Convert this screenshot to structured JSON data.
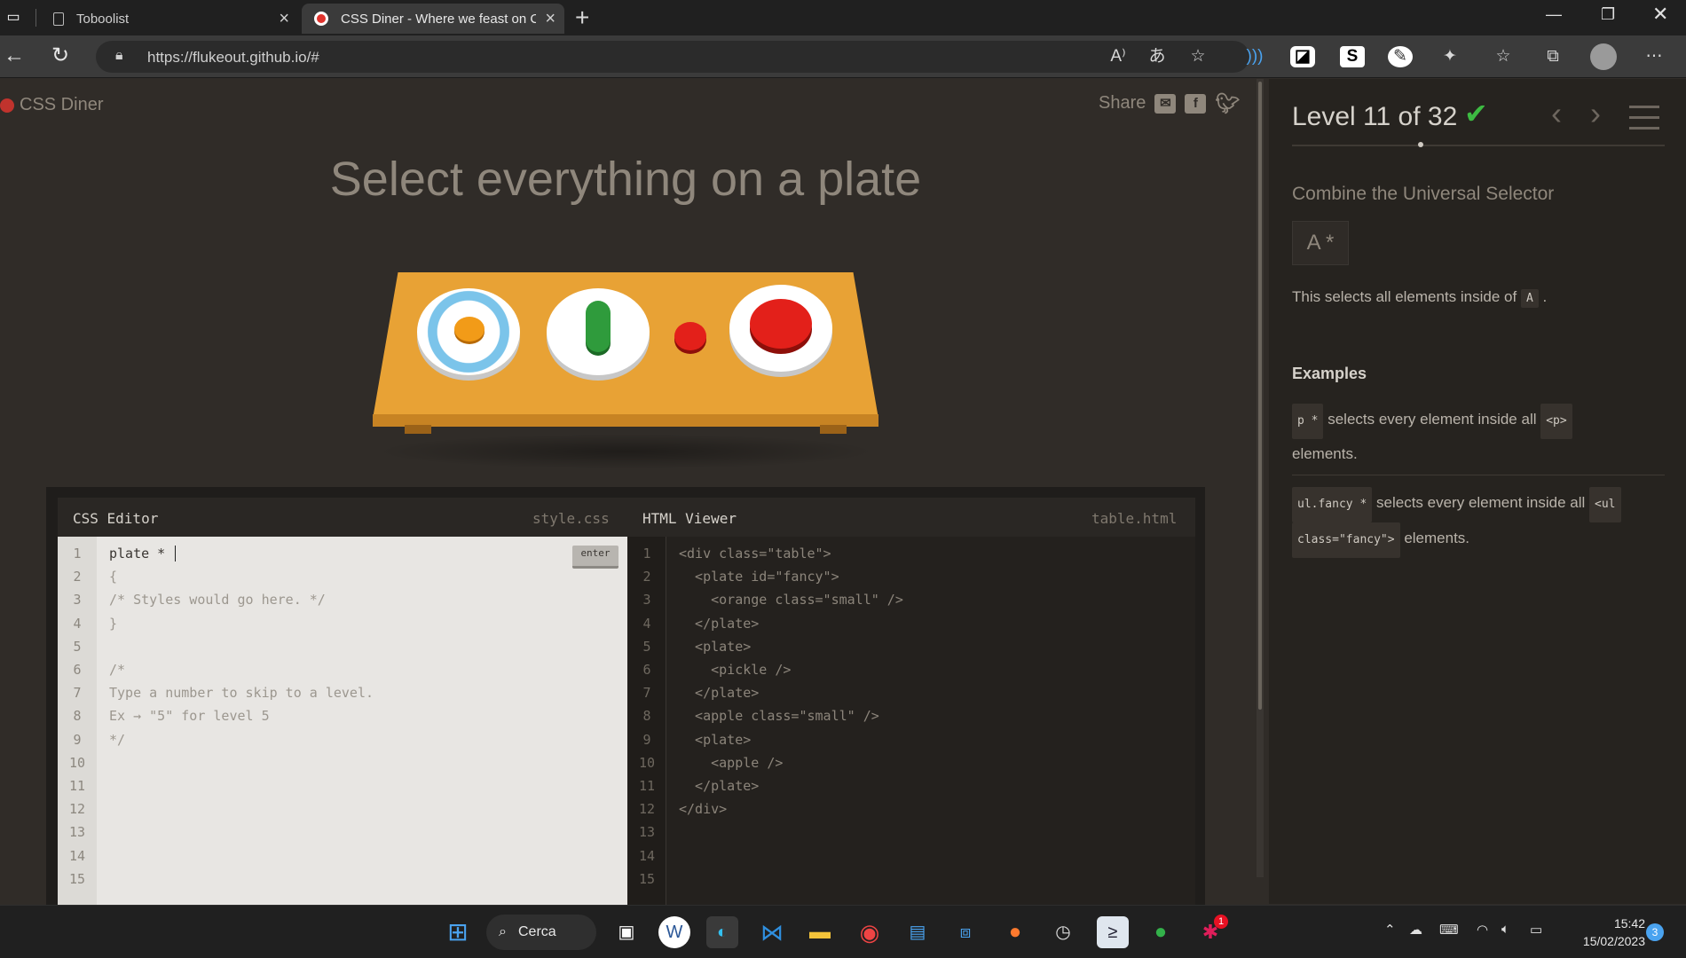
{
  "browser": {
    "tabs": [
      {
        "label": "Toboolist",
        "active": false
      },
      {
        "label": "CSS Diner - Where we feast on C",
        "active": true
      }
    ],
    "url": "https://flukeout.github.io/#",
    "window_controls": [
      "minimize",
      "restore",
      "close"
    ]
  },
  "page": {
    "brand": "CSS Diner",
    "share_label": "Share",
    "share_icons": [
      "mail-icon",
      "facebook-icon",
      "twitter-icon"
    ],
    "title": "Select everything on a plate"
  },
  "editor": {
    "css_title": "CSS Editor",
    "css_file": "style.css",
    "html_title": "HTML Viewer",
    "html_file": "table.html",
    "enter_label": "enter",
    "css_lines": [
      "plate * ",
      "{",
      "/* Styles would go here. */",
      "}",
      "",
      "/*",
      "Type a number to skip to a level.",
      "Ex → \"5\" for level 5",
      "*/",
      "",
      "",
      "",
      "",
      "",
      ""
    ],
    "html_lines": [
      "<div class=\"table\">",
      "  <plate id=\"fancy\">",
      "    <orange class=\"small\" />",
      "  </plate>",
      "  <plate>",
      "    <pickle />",
      "  </plate>",
      "  <apple class=\"small\" />",
      "  <plate>",
      "    <apple />",
      "  </plate>",
      "</div>",
      "",
      "",
      ""
    ],
    "line_numbers": [
      "1",
      "2",
      "3",
      "4",
      "5",
      "6",
      "7",
      "8",
      "9",
      "10",
      "11",
      "12",
      "13",
      "14",
      "15"
    ]
  },
  "sidebar": {
    "level": "Level 11 of 32",
    "check": "✔",
    "prev": "‹",
    "next": "›",
    "subtitle": "Combine the Universal Selector",
    "syntax": "A  *",
    "hint_prefix": "This selects all elements inside of",
    "hint_tag": "A",
    "hint_suffix": ".",
    "examples_heading": "Examples",
    "example1_tag": "p  *",
    "example1_text": "selects every element inside all",
    "example1_tag2": "<p>",
    "example1_tail": "elements.",
    "example2_tag": "ul.fancy  *",
    "example2_text": "selects every element inside all",
    "example2_tag2a": "<ul",
    "example2_tag2b": "class=\"fancy\">",
    "example2_tail": "elements."
  },
  "taskbar": {
    "search_label": "Cerca",
    "time": "15:42",
    "date": "15/02/2023",
    "notifications": "3",
    "slack_badge": "1"
  },
  "colors": {
    "page_bg": "#302c28",
    "sidebar_bg": "#26231f",
    "accent_check": "#3dbb42",
    "table": "#e8a235",
    "apple": "#e3201a",
    "orange": "#f29b18",
    "pickle": "#2f9b3c"
  }
}
